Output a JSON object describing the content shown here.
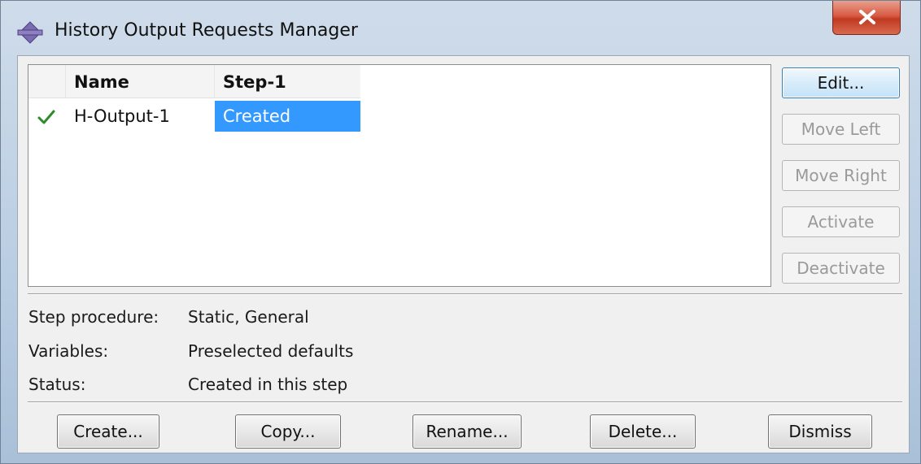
{
  "window": {
    "title": "History Output Requests Manager",
    "close_symbol": "✕"
  },
  "table": {
    "columns": [
      "",
      "Name",
      "Step-1"
    ],
    "rows": [
      {
        "status_icon": "checkmark-icon",
        "name": "H-Output-1",
        "step1": "Created",
        "step1_selected": true
      }
    ]
  },
  "side_buttons": {
    "edit": "Edit...",
    "move_left": "Move Left",
    "move_right": "Move Right",
    "activate": "Activate",
    "deactivate": "Deactivate"
  },
  "info": {
    "step_procedure_label": "Step procedure:",
    "step_procedure_value": "Static, General",
    "variables_label": "Variables:",
    "variables_value": "Preselected defaults",
    "status_label": "Status:",
    "status_value": "Created in this step"
  },
  "bottom_buttons": {
    "create": "Create...",
    "copy": "Copy...",
    "rename": "Rename...",
    "delete": "Delete...",
    "dismiss": "Dismiss"
  },
  "colors": {
    "selection": "#3399ff",
    "check": "#2e8b2e",
    "close_button": "#d75a41"
  }
}
